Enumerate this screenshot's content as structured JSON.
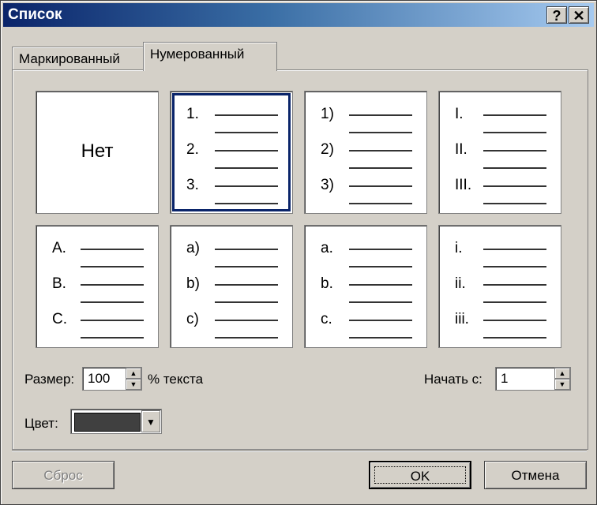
{
  "window": {
    "title": "Список",
    "help_label": "?",
    "close_label": "✕"
  },
  "tabs": [
    {
      "label": "Маркированный",
      "active": false
    },
    {
      "label": "Нумерованный",
      "active": true
    }
  ],
  "styles": [
    {
      "type": "none",
      "text": "Нет"
    },
    {
      "type": "list",
      "markers": [
        "1.",
        "2.",
        "3."
      ],
      "selected": true
    },
    {
      "type": "list",
      "markers": [
        "1)",
        "2)",
        "3)"
      ]
    },
    {
      "type": "list",
      "markers": [
        "I.",
        "II.",
        "III."
      ]
    },
    {
      "type": "list",
      "markers": [
        "A.",
        "B.",
        "C."
      ]
    },
    {
      "type": "list",
      "markers": [
        "a)",
        "b)",
        "c)"
      ]
    },
    {
      "type": "list",
      "markers": [
        "a.",
        "b.",
        "c."
      ]
    },
    {
      "type": "list",
      "markers": [
        "i.",
        "ii.",
        "iii."
      ]
    }
  ],
  "size": {
    "label": "Размер:",
    "value": "100",
    "suffix": "% текста"
  },
  "start": {
    "label": "Начать с:",
    "value": "1"
  },
  "color": {
    "label": "Цвет:",
    "swatch": "#404040"
  },
  "buttons": {
    "reset": "Сброс",
    "ok": "OK",
    "cancel": "Отмена"
  }
}
